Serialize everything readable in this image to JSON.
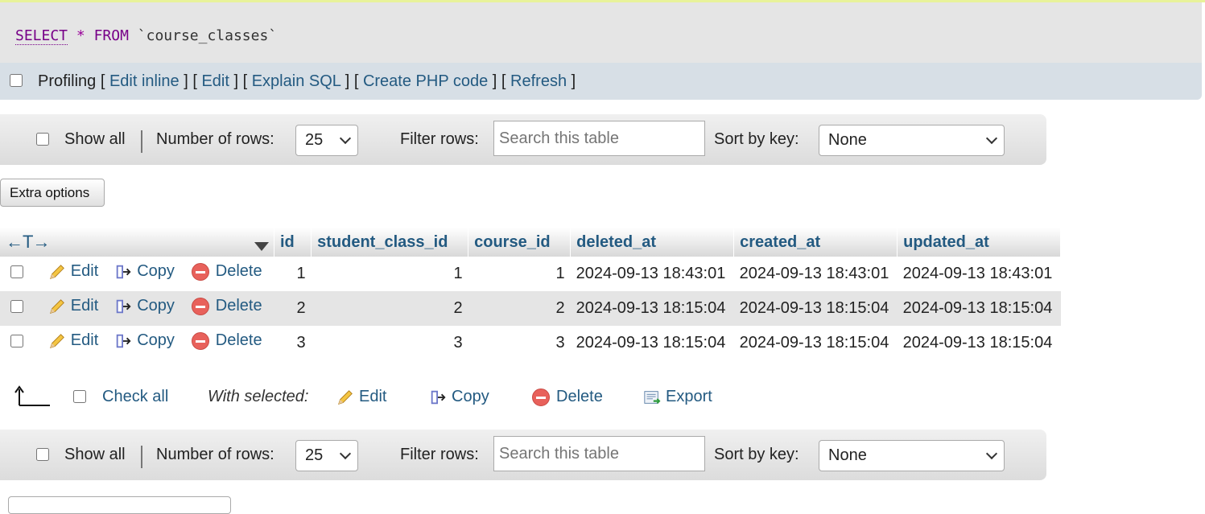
{
  "sql": {
    "select": "SELECT",
    "star": "*",
    "from": "FROM",
    "table": "`course_classes`"
  },
  "tools": {
    "profiling": "Profiling",
    "links": [
      "Edit inline",
      "Edit",
      "Explain SQL",
      "Create PHP code",
      "Refresh"
    ]
  },
  "nav_top": {
    "show_all": "Show all",
    "number_of_rows_label": "Number of rows:",
    "number_of_rows_value": "25",
    "filter_label": "Filter rows:",
    "filter_placeholder": "Search this table",
    "sort_label": "Sort by key:",
    "sort_value": "None"
  },
  "nav_bottom": {
    "show_all": "Show all",
    "number_of_rows_label": "Number of rows:",
    "number_of_rows_value": "25",
    "filter_label": "Filter rows:",
    "filter_placeholder": "Search this table",
    "sort_label": "Sort by key:",
    "sort_value": "None"
  },
  "extra_options": "Extra options",
  "table": {
    "resize_glyph": "←T→",
    "columns": [
      "id",
      "student_class_id",
      "course_id",
      "deleted_at",
      "created_at",
      "updated_at"
    ],
    "actions": {
      "edit": "Edit",
      "copy": "Copy",
      "delete": "Delete"
    },
    "rows": [
      [
        "1",
        "1",
        "1",
        "2024-09-13 18:43:01",
        "2024-09-13 18:43:01",
        "2024-09-13 18:43:01"
      ],
      [
        "2",
        "2",
        "2",
        "2024-09-13 18:15:04",
        "2024-09-13 18:15:04",
        "2024-09-13 18:15:04"
      ],
      [
        "3",
        "3",
        "3",
        "2024-09-13 18:15:04",
        "2024-09-13 18:15:04",
        "2024-09-13 18:15:04"
      ]
    ]
  },
  "bulk": {
    "check_all": "Check all",
    "with_selected": "With selected:",
    "edit": "Edit",
    "copy": "Copy",
    "delete": "Delete",
    "export": "Export"
  },
  "colors": {
    "link": "#235a81",
    "keyword": "#770088",
    "delete_icon": "#e8615b",
    "row_alt": "#e5e5e5",
    "tools_bg": "#d7dfe6"
  }
}
